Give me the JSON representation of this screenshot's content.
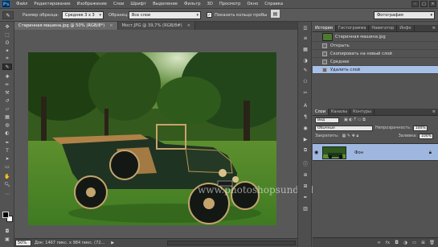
{
  "app": {
    "logo": "Ps"
  },
  "menu": [
    "Файл",
    "Редактирование",
    "Изображение",
    "Слои",
    "Шрифт",
    "Выделение",
    "Фильтр",
    "3D",
    "Просмотр",
    "Окно",
    "Справка"
  ],
  "options_bar": {
    "sample_size_label": "Размер образца:",
    "sample_size_value": "Среднее 3 x 3",
    "sample_label": "Образец:",
    "sample_value": "Все слои",
    "show_ring_label": "Показать кольцо пробы",
    "show_ring_checked": true
  },
  "workspace": {
    "value": "Фотография"
  },
  "document_tabs": [
    {
      "label": "Старинная машина.jpg @ 50% (RGB/8*)",
      "close": "×",
      "active": true
    },
    {
      "label": "Мост.JPG @ 39,7% (RGB/8#)",
      "close": "×",
      "active": false
    }
  ],
  "watermark": "www.photoshopsunduchok.ru",
  "status_bar": {
    "zoom": "50%",
    "info": "Док: 1467 пикс. x 984 пикс. (72...",
    "arrow": "▶"
  },
  "history_panel": {
    "tabs": [
      "История",
      "Гистограмма",
      "Навигатор",
      "Инфо"
    ],
    "snapshot": "Старинная машина.jpg",
    "steps": [
      {
        "label": "Открыть",
        "selected": false
      },
      {
        "label": "Скопировать на новый слой",
        "selected": false
      },
      {
        "label": "Среднее",
        "selected": false
      },
      {
        "label": "Удалить слой",
        "selected": true
      }
    ]
  },
  "layers_panel": {
    "tabs": [
      "Слои",
      "Каналы",
      "Контуры"
    ],
    "kind_filter": "Вид",
    "blend_mode": "Обычные",
    "opacity_label": "Непрозрачность:",
    "opacity_value": "100%",
    "lock_label": "Закрепить:",
    "fill_label": "Заливка:",
    "fill_value": "100%",
    "layer_name": "Фон",
    "lock_icon": "lock-icon"
  },
  "colors": {
    "selection_blue": "#a7c0e8",
    "panel_gray": "#535353",
    "foreground": "#000000",
    "background": "#ffffff"
  }
}
